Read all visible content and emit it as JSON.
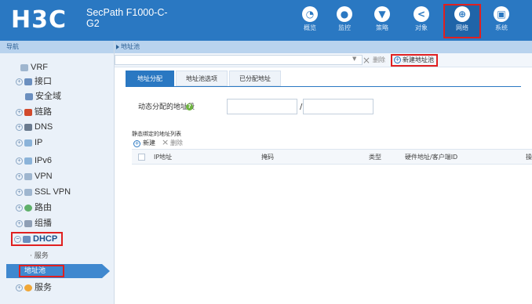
{
  "header": {
    "logo": "H3C",
    "product": "SecPath F1000-C-G2",
    "nav": [
      {
        "label": "概览",
        "icon": "dashboard-icon"
      },
      {
        "label": "监控",
        "icon": "monitor-icon"
      },
      {
        "label": "策略",
        "icon": "policy-icon"
      },
      {
        "label": "对象",
        "icon": "object-icon"
      },
      {
        "label": "网络",
        "icon": "network-icon"
      },
      {
        "label": "系统",
        "icon": "system-icon"
      }
    ]
  },
  "sidebar": {
    "header": "导航",
    "items": [
      {
        "label": "VRF"
      },
      {
        "label": "接口"
      },
      {
        "label": "安全域"
      },
      {
        "label": "链路"
      },
      {
        "label": "DNS"
      },
      {
        "label": "IP"
      },
      {
        "label": "IPv6"
      },
      {
        "label": "VPN"
      },
      {
        "label": "SSL VPN"
      },
      {
        "label": "路由"
      },
      {
        "label": "组播"
      },
      {
        "label": "DHCP"
      }
    ],
    "dhcp_children": [
      {
        "label": "服务"
      },
      {
        "label": "地址池"
      }
    ],
    "last": {
      "label": "服务"
    }
  },
  "breadcrumb": "地址池",
  "toolbar": {
    "delete": "删除",
    "new_pool": "新建地址池"
  },
  "tabs": [
    {
      "label": "地址分配"
    },
    {
      "label": "地址池选项"
    },
    {
      "label": "已分配地址"
    }
  ],
  "form": {
    "dynamic_range_label": "动态分配的地址段",
    "separator": "/"
  },
  "static_list": {
    "title": "静态绑定的地址列表",
    "new": "新建",
    "delete": "删除",
    "columns": [
      "IP地址",
      "掩码",
      "类型",
      "硬件地址/客户端ID",
      "操"
    ]
  },
  "colors": {
    "brand": "#2a78c2",
    "highlight": "#e02020"
  }
}
